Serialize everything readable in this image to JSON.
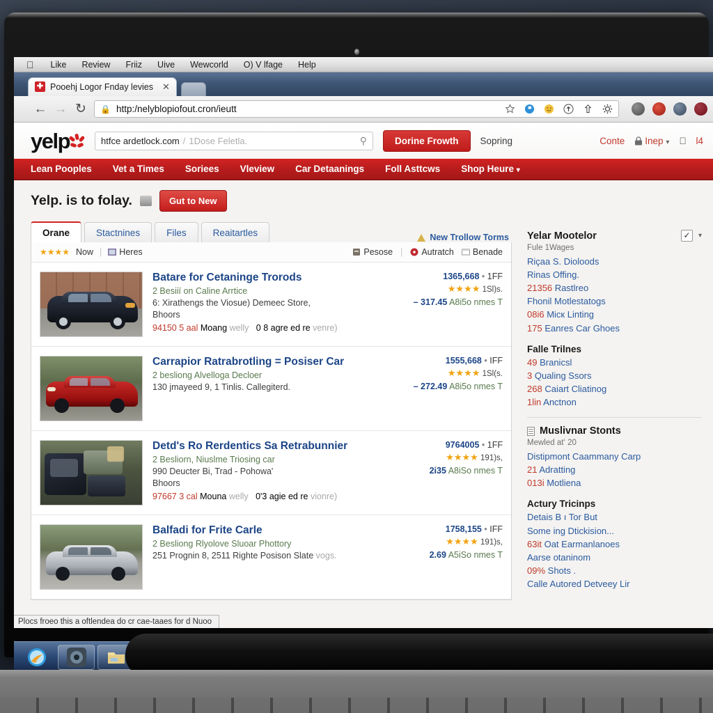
{
  "os_menubar": {
    "apple_icon": "apple-icon",
    "items": [
      "Like",
      "Review",
      "Friiz",
      "Uive",
      "Wewcorld",
      "O) V lfage",
      "Help"
    ]
  },
  "browser": {
    "tab": {
      "favicon": "yelp-favicon",
      "title": "Pooehj Logor Fnday levies",
      "close_icon": "close-icon"
    },
    "new_tab_icon": "new-tab-icon",
    "back_icon": "back-arrow-icon",
    "forward_icon": "forward-arrow-icon",
    "reload_icon": "reload-icon",
    "lock_icon": "lock-icon",
    "url": "http:/nelyblopiofout.cron/ieutt",
    "omnibox_icons": [
      "star-icon",
      "bookmark-blue-icon",
      "smiley-icon",
      "upload-icon",
      "share-icon",
      "gear-icon"
    ],
    "extension_icons": [
      "extension-gray-icon",
      "extension-red-icon",
      "extension-blue-icon",
      "extension-maroon-icon"
    ]
  },
  "yelp": {
    "logo_text": "yelp",
    "logo_burst": "yelp-burst-icon",
    "search": {
      "value": "htfce ardetlock.com",
      "separator": "/",
      "placeholder": "1Dose Feletla.",
      "magnifier_icon": "search-icon"
    },
    "primary_button": "Dorine Frowth",
    "secondary_link": "Sopring",
    "header_links": [
      "Conte"
    ],
    "account": {
      "lock_icon": "lock-icon",
      "label": "Inep",
      "caret_icon": "chevron-down-icon"
    },
    "apple_icon": "apple-icon",
    "apple_label": "l4",
    "nav": [
      "Lean Pooples",
      "Vet a Times",
      "Soriees",
      "Vleview",
      "Car Detaanings",
      "Foll Asttcws",
      "Shop Heure"
    ],
    "nav_caret_icon": "chevron-down-icon"
  },
  "title_row": {
    "heading": "Yelp. is to folay.",
    "badge_icon": "seal-badge-icon",
    "cta": "Gut to New"
  },
  "tabs": {
    "items": [
      "Orane",
      "Stactnines",
      "Files",
      "Reaitartles"
    ],
    "active_index": 0,
    "aux_link": "New Trollow Torms",
    "aux_icon": "warning-triangle-icon"
  },
  "filterbar": {
    "stars_icon": "four-stars-icon",
    "left": [
      "Now",
      "Heres"
    ],
    "left_icon": "photo-icon",
    "right": [
      {
        "icon": "archive-icon",
        "label": "Pesose"
      },
      {
        "icon": "record-icon",
        "label": "Autratch"
      },
      {
        "icon": "note-icon",
        "label": "Benade"
      }
    ]
  },
  "listings": [
    {
      "thumb": "black-sedan-photo",
      "title": "Batare for Cetaninge Trorods",
      "subtitle": "2 Besiiï on Caline Arrtice",
      "address": "6: Xirathengs the Viosue) Demeec Store,",
      "address2": "Bhoors",
      "phone": "94150",
      "cat": "5 aal",
      "meta": "Moang",
      "meta_gray": "welly",
      "meta2": "0 8 agre ed re",
      "meta2_gray": "venre)",
      "id": "1365,668",
      "id_tag": "1FF",
      "stars_icon": "four-stars-icon",
      "reviews": "1Sl)s.",
      "price": "– 317.45",
      "price_note": "A8i5o nmes T"
    },
    {
      "thumb": "red-coupe-photo",
      "title": "Carrapior Ratrabrotling = Posiser Car",
      "subtitle": "2 besliong Alvelloga Decloer",
      "address": "130 jmayeed 9, 1 Tinlis. Callegiterd.",
      "address2": "",
      "phone": "",
      "cat": "",
      "meta": "",
      "meta_gray": "",
      "meta2": "",
      "meta2_gray": "",
      "id": "1555,668",
      "id_tag": "IFF",
      "stars_icon": "four-stars-icon",
      "reviews": "1Sl(s.",
      "price": "– 272.49",
      "price_note": "A8i5o nmes T"
    },
    {
      "thumb": "car-interior-photo",
      "title": "Detd's Ro Rerdentics Sa Retrabunnier",
      "subtitle": "2 Besliorn, Niuslme Triosing car",
      "address": "990 Deucter Bi, Trad - Pohowa'",
      "address2": "Bhoors",
      "phone": "97667",
      "cat": "3 cal",
      "meta": "Mouna",
      "meta_gray": "welly",
      "meta2": "0'3 agie ed re",
      "meta2_gray": "vionre)",
      "id": "9764005",
      "id_tag": "1FF",
      "stars_icon": "four-stars-icon",
      "reviews": "191)s,",
      "price": "2i35",
      "price_note": "A8iSo nmes T"
    },
    {
      "thumb": "silver-sedan-photo",
      "title": "Balfadi for Frite Carle",
      "subtitle": "2 Besliong Rlyolove Sluoar Phottory",
      "address": "251 Prognin 8, 2511 Righte Posison Slate",
      "address_gray": "vogs.",
      "address2": "",
      "phone": "",
      "cat": "",
      "meta": "",
      "meta_gray": "",
      "meta2": "",
      "meta2_gray": "",
      "id": "1758,155",
      "id_tag": "IFF",
      "stars_icon": "four-stars-icon",
      "reviews": "191)s,",
      "price": "2.69",
      "price_note": "A5iSo nmes T"
    }
  ],
  "sidebar": {
    "header": "Yelar Mootelor",
    "checkbox_icon": "checkbox-checked-icon",
    "caret_icon": "chevron-down-icon",
    "sub": "Fule 1Wages",
    "links": [
      {
        "num": "",
        "text": "Riçaa S. Diolo​ods"
      },
      {
        "num": "",
        "text": "Rinas Offing."
      },
      {
        "num": "21356",
        "text": "Rastlreo"
      },
      {
        "num": "",
        "text": "Fhonil Motlestatogs"
      },
      {
        "num": "08i6",
        "text": "Micк Linting"
      },
      {
        "num": "175",
        "text": "Eanres Car Ghoes"
      }
    ],
    "block2": {
      "title": "Falle Trilnes",
      "links": [
        {
          "num": "49",
          "text": "Branicsl"
        },
        {
          "num": "3",
          "text": "Qualing Ssors"
        },
        {
          "num": "268",
          "text": "Caiart Cliatinog"
        },
        {
          "num": "1lin",
          "text": "Anctnon"
        }
      ]
    },
    "block3": {
      "icon": "list-icon",
      "title": "Muslivnar Stonts",
      "sub": "Mewled atʻ 20",
      "links": [
        {
          "num": "",
          "text": "Distipmont Caammany Carp"
        },
        {
          "num": "21",
          "text": "Adratting"
        },
        {
          "num": "013i",
          "text": "Motliena"
        }
      ]
    },
    "block4": {
      "title": "Actury Tricinps",
      "links": [
        {
          "num": "",
          "text": "Detais B ı Tor But"
        },
        {
          "num": "",
          "text": "Some ing Dtickision..."
        },
        {
          "num": "63it",
          "text": "Oat Earmanlanoes"
        },
        {
          "num": "",
          "text": "Aarse otaninom"
        },
        {
          "num": "09%",
          "text": "Shots ."
        },
        {
          "num": "",
          "text": "Calle Autored Detveey Lir"
        }
      ]
    }
  },
  "status_bubble": "Plocs froeo this a oftlendea do cr cae-taaes for d Nuoo",
  "taskbar": {
    "items": [
      {
        "name": "start-orb",
        "color": "#2f9bdc"
      },
      {
        "name": "media-player-icon",
        "color": "#4d5a66"
      },
      {
        "name": "folder-icon",
        "color": "#ead98a"
      },
      {
        "name": "chrome-icon",
        "color": "#3aa757"
      },
      {
        "name": "notepad-icon",
        "color": "#f2efd8"
      },
      {
        "name": "paint-icon",
        "color": "#d8452e"
      },
      {
        "name": "facebook-icon",
        "color": "#3b5998"
      },
      {
        "name": "record-icon",
        "color": "#d4202a"
      },
      {
        "name": "excel-icon",
        "color": "#4caf50"
      }
    ]
  }
}
